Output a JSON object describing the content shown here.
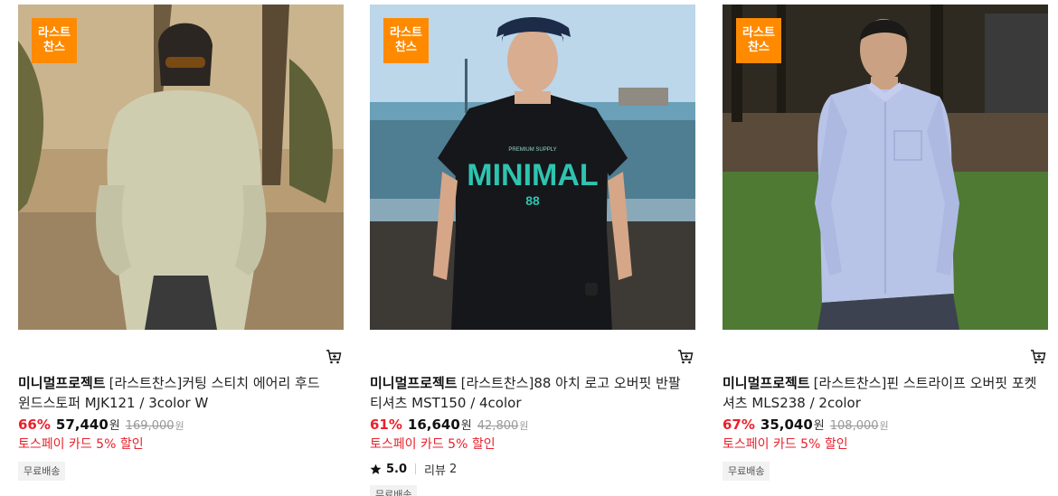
{
  "badge_line1": "라스트",
  "badge_line2": "찬스",
  "products": [
    {
      "brand": "미니멀프로젝트",
      "name": "[라스트찬스]커팅 스티치 에어리 후드 윈드스토퍼 MJK121 / 3color W",
      "discount": "66%",
      "price": "57,440",
      "currency": "원",
      "original_price": "169,000",
      "promo": "토스페이 카드 5% 할인",
      "shipping": "무료배송"
    },
    {
      "brand": "미니멀프로젝트",
      "name": "[라스트찬스]88 아치 로고 오버핏 반팔 티셔츠 MST150 / 4color",
      "discount": "61%",
      "price": "16,640",
      "currency": "원",
      "original_price": "42,800",
      "promo": "토스페이 카드 5% 할인",
      "rating": "5.0",
      "review_label": "리뷰",
      "review_count": "2",
      "shipping": "무료배송",
      "tee_print_top": "PREMIUM SUPPLY",
      "tee_print_main": "MINIMAL",
      "tee_print_number": "88"
    },
    {
      "brand": "미니멀프로젝트",
      "name": "[라스트찬스]핀 스트라이프 오버핏 포켓 셔츠 MLS238 / 2color",
      "discount": "67%",
      "price": "35,040",
      "currency": "원",
      "original_price": "108,000",
      "promo": "토스페이 카드 5% 할인",
      "shipping": "무료배송"
    }
  ],
  "icons": {
    "cart": "cart-icon",
    "star": "star-icon"
  },
  "colors": {
    "badge": "#ff8a00",
    "sale": "#e8222c"
  }
}
